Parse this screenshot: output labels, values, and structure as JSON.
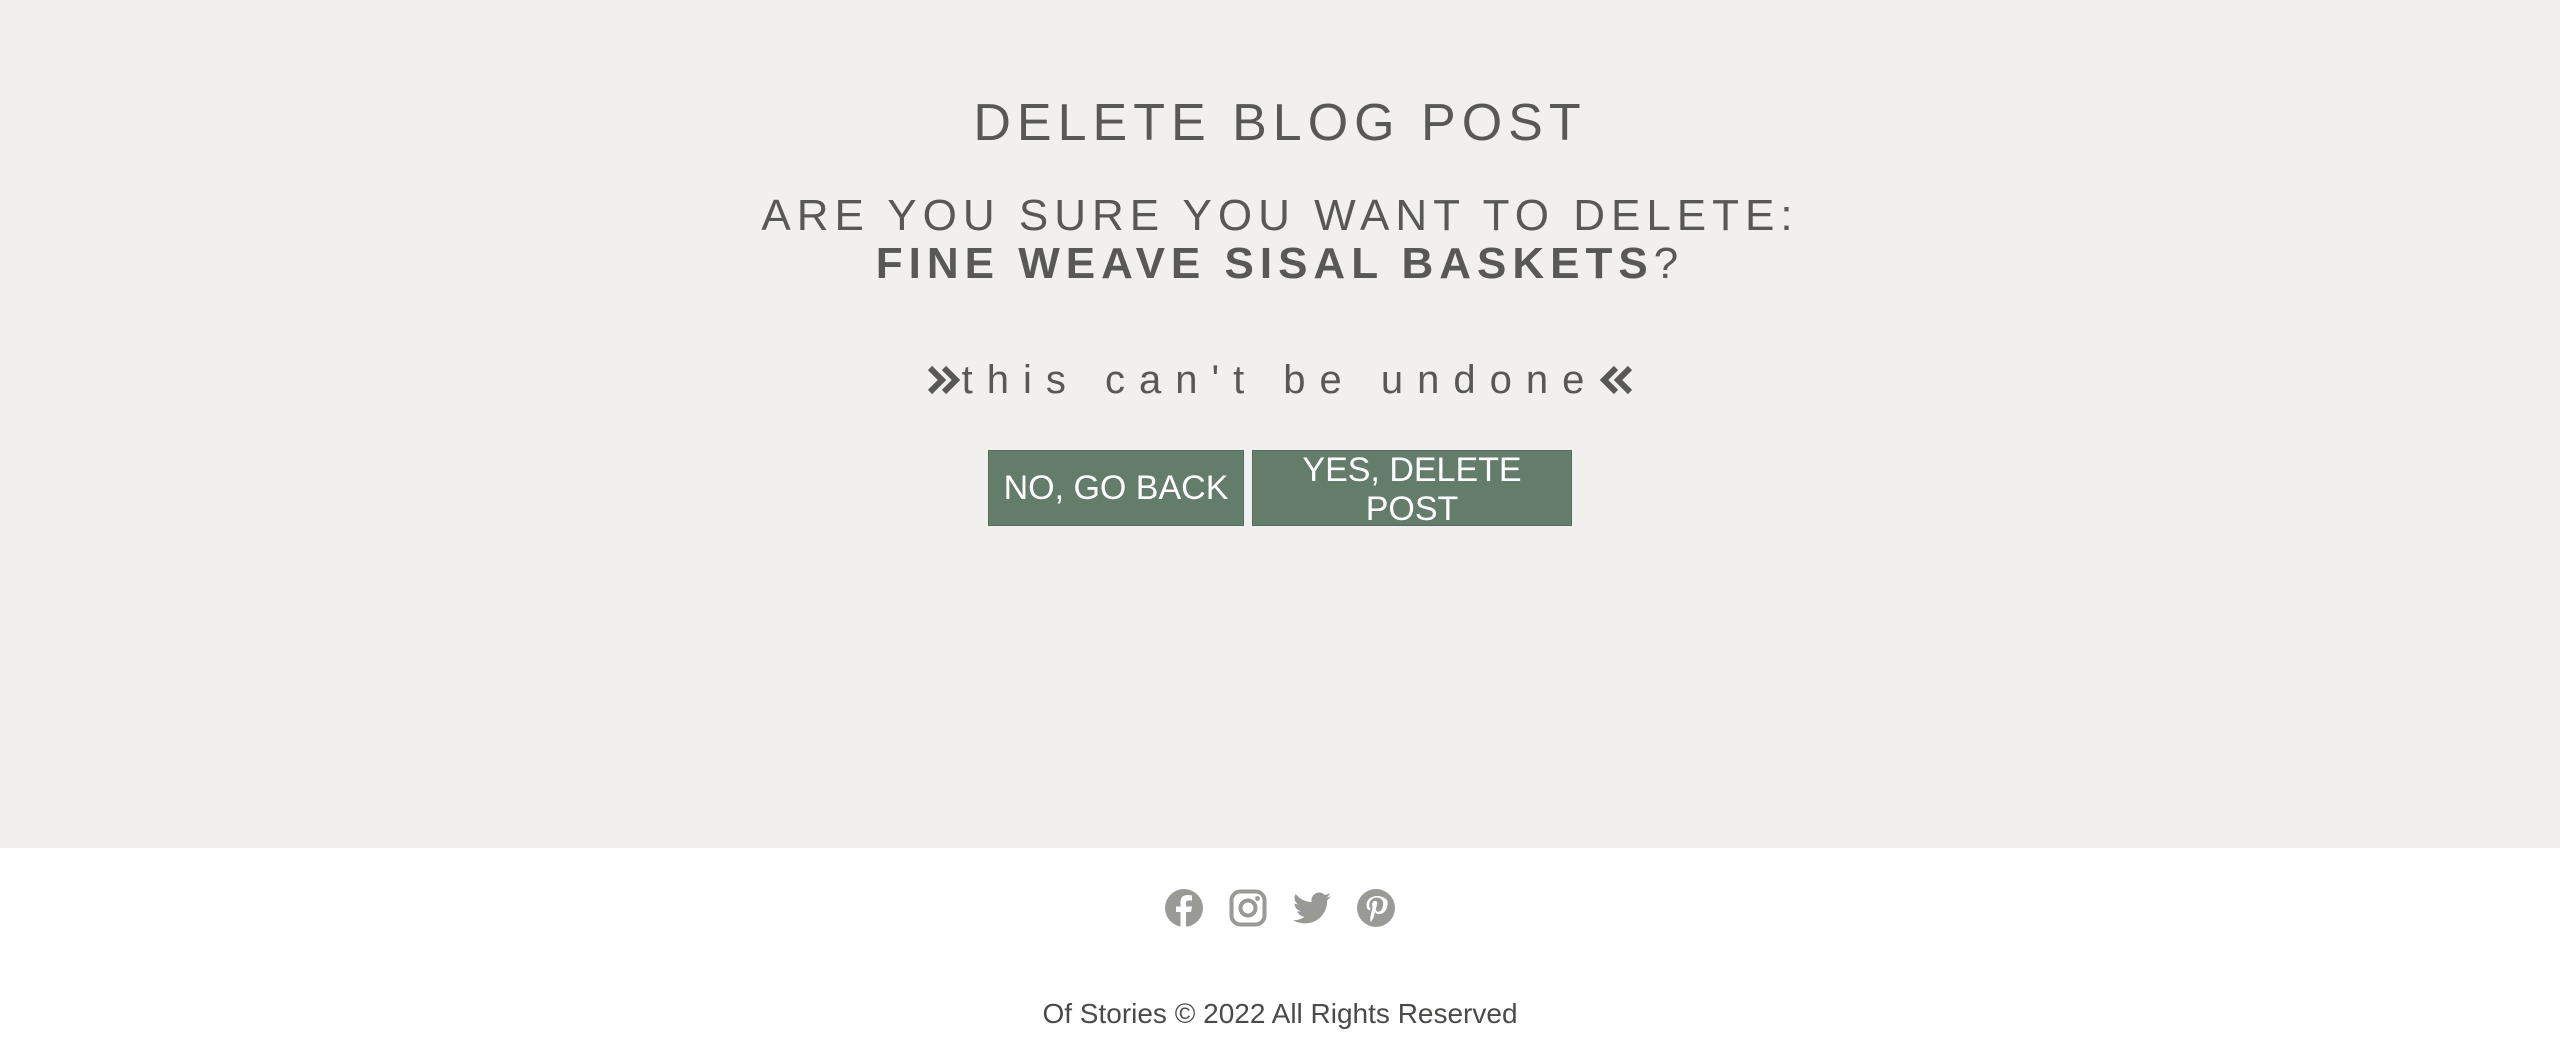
{
  "page": {
    "title": "DELETE BLOG POST",
    "question_prefix": "ARE YOU SURE YOU WANT TO DELETE:",
    "post_title": "FINE WEAVE SISAL BASKETS",
    "question_suffix": "?",
    "warning": "this can't be undone"
  },
  "buttons": {
    "back_label": "NO, GO BACK",
    "delete_label": "YES, DELETE POST"
  },
  "footer": {
    "social": [
      {
        "name": "facebook-icon"
      },
      {
        "name": "instagram-icon"
      },
      {
        "name": "twitter-icon"
      },
      {
        "name": "pinterest-icon"
      }
    ],
    "copyright": "Of Stories © 2022 All Rights Reserved"
  },
  "colors": {
    "background": "#f2f0ef",
    "text": "#585856",
    "button": "#647c6a",
    "icon": "#999a96"
  }
}
